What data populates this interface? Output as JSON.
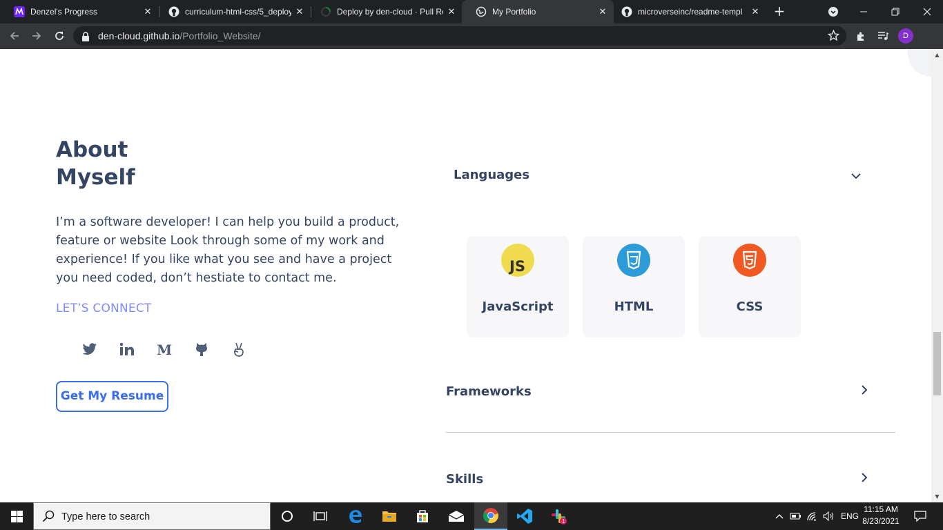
{
  "browser": {
    "tabs": [
      {
        "title": "Denzel's Progress",
        "icon": "microverse-icon",
        "active": false
      },
      {
        "title": "curriculum-html-css/5_deploy",
        "icon": "github-icon",
        "active": false
      },
      {
        "title": "Deploy by den-cloud · Pull Re",
        "icon": "github-loading-icon",
        "active": false
      },
      {
        "title": "My Portfolio",
        "icon": "globe-icon",
        "active": true
      },
      {
        "title": "microverseinc/readme-templ",
        "icon": "github-icon",
        "active": false
      }
    ],
    "close_glyph": "✕",
    "new_tab_glyph": "+",
    "address": {
      "host": "den-cloud.github.io",
      "path": "/Portfolio_Website/"
    },
    "profile_initial": "D",
    "accent": "#8430ce"
  },
  "about": {
    "title_line1": "About",
    "title_line2": "Myself",
    "description": "I’m a software developer! I can help you build a product, feature or website Look through some of my work and experience! If you like what you see and have a project you need coded, don’t hestiate to contact me.",
    "connect_label": "LET’S CONNECT",
    "socials": [
      "twitter-icon",
      "linkedin-icon",
      "medium-icon",
      "github-icon",
      "angellist-icon"
    ],
    "resume_button": "Get My Resume"
  },
  "skills": {
    "languages": {
      "heading": "Languages",
      "expanded": true,
      "items": [
        {
          "name": "JavaScript",
          "badge": "JS",
          "color": "#f0db4f"
        },
        {
          "name": "HTML",
          "badge": "3",
          "color": "#2d9bd8"
        },
        {
          "name": "CSS",
          "badge": "5",
          "color": "#f05a22"
        }
      ]
    },
    "frameworks": {
      "heading": "Frameworks",
      "expanded": false
    },
    "skills": {
      "heading": "Skills",
      "expanded": false
    }
  },
  "colors": {
    "heading": "#344563",
    "connect": "#7f8cff",
    "button": "#396df2"
  },
  "taskbar": {
    "search_placeholder": "Type here to search",
    "apps": [
      "cortana-icon",
      "task-view-icon",
      "edge-icon",
      "file-explorer-icon",
      "store-icon",
      "mail-icon",
      "chrome-icon",
      "vscode-icon",
      "slack-icon"
    ],
    "active_app": "chrome-icon",
    "slack_badge": "1",
    "language": "ENG",
    "time": "11:15 AM",
    "date": "8/23/2021"
  }
}
